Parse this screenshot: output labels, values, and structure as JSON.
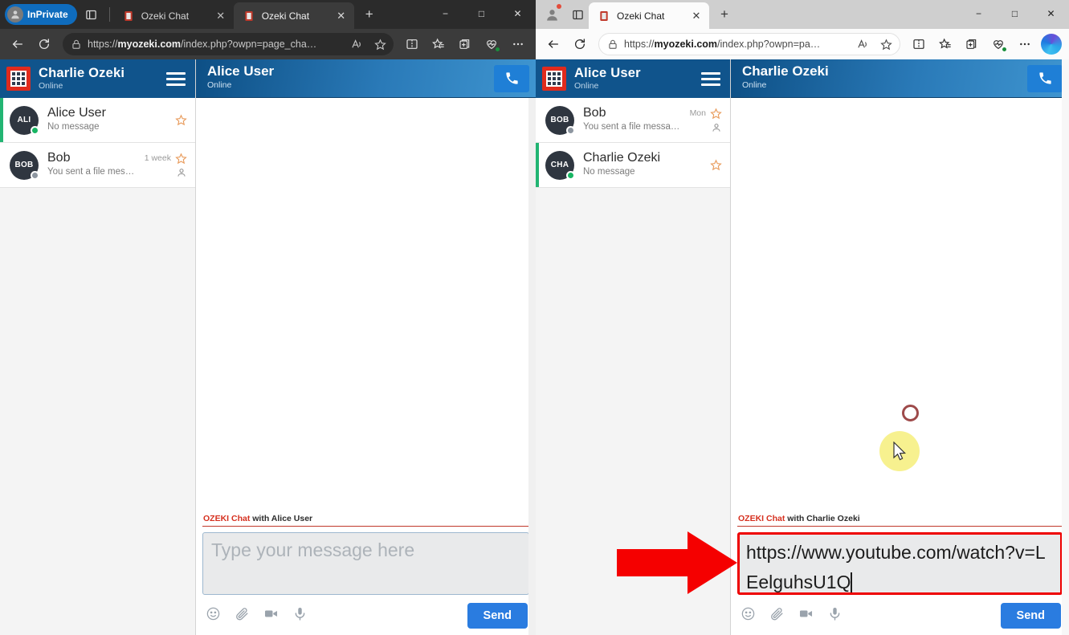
{
  "left_window": {
    "profile_label": "InPrivate",
    "tabs": [
      {
        "title": "Ozeki Chat",
        "active": false
      },
      {
        "title": "Ozeki Chat",
        "active": true
      }
    ],
    "new_tab_label": "+",
    "window_controls": {
      "minimize": "−",
      "maximize": "□",
      "close": "✕"
    },
    "address": {
      "scheme": "https://",
      "domain": "myozeki.com",
      "path": "/index.php?owpn=page_cha…"
    },
    "app": {
      "sidebar": {
        "account_name": "Charlie Ozeki",
        "account_status": "Online",
        "contacts": [
          {
            "name": "Alice User",
            "preview": "No message",
            "time": "",
            "initials": "ALI",
            "presence": "online",
            "selected": true,
            "has_person_icon": false
          },
          {
            "name": "Bob",
            "preview": "You sent a file message.",
            "time": "1 week",
            "initials": "BOB",
            "presence": "offline",
            "selected": false,
            "has_person_icon": true
          }
        ]
      },
      "chat": {
        "peer_name": "Alice User",
        "peer_status": "Online",
        "composer_label_brand": "OZEKI Chat",
        "composer_label_rest": " with Alice User",
        "input_placeholder": "Type your message here",
        "input_value": "",
        "send_label": "Send"
      }
    }
  },
  "right_window": {
    "tabs": [
      {
        "title": "Ozeki Chat",
        "active": true
      }
    ],
    "new_tab_label": "+",
    "window_controls": {
      "minimize": "−",
      "maximize": "□",
      "close": "✕"
    },
    "address": {
      "scheme": "https://",
      "domain": "myozeki.com",
      "path": "/index.php?owpn=pa…"
    },
    "app": {
      "sidebar": {
        "account_name": "Alice User",
        "account_status": "Online",
        "contacts": [
          {
            "name": "Bob",
            "preview": "You sent a file message.",
            "time": "Mon",
            "initials": "BOB",
            "presence": "offline",
            "selected": false,
            "has_person_icon": true
          },
          {
            "name": "Charlie Ozeki",
            "preview": "No message",
            "time": "",
            "initials": "CHA",
            "presence": "online",
            "selected": true,
            "has_person_icon": false
          }
        ]
      },
      "chat": {
        "peer_name": "Charlie Ozeki",
        "peer_status": "Online",
        "composer_label_brand": "OZEKI Chat",
        "composer_label_rest": " with Charlie Ozeki",
        "input_placeholder": "",
        "input_value": "https://www.youtube.com/watch?v=LEelguhsU1Q",
        "send_label": "Send"
      }
    }
  },
  "colors": {
    "sidebar_header": "#10548c",
    "chat_header_start": "#0d4f85",
    "chat_header_end": "#3f95d0",
    "send_button": "#2a7ce0",
    "ozeki_red": "#d6301f",
    "highlight_red": "#ee0000",
    "online_green": "#18b563",
    "offline_gray": "#8d96a0",
    "selected_bar": "#22b573",
    "cursor_halo": "#f7f18f",
    "ring": "#9e4a4a"
  },
  "icons": {
    "back": "back-arrow-icon",
    "reload": "reload-icon",
    "lock": "lock-icon",
    "read_aloud": "read-aloud-icon",
    "favorite": "star-outline-icon",
    "split_screen": "split-screen-icon",
    "favorites_hub": "favorites-icon",
    "collections": "collections-icon",
    "browser_essentials": "browser-essentials-icon",
    "settings": "ellipsis-icon",
    "copilot": "copilot-icon",
    "call": "phone-icon",
    "emoji": "emoji-icon",
    "attach": "paperclip-icon",
    "video": "video-camera-icon",
    "mic": "microphone-icon",
    "menu": "hamburger-icon"
  }
}
